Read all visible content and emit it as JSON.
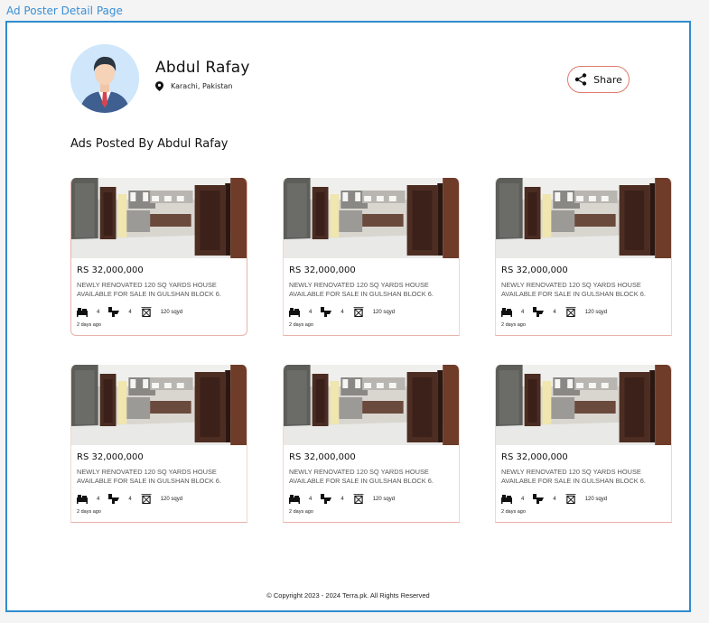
{
  "page_label": "Ad Poster Detail Page",
  "profile": {
    "name": "Abdul Rafay",
    "location": "Karachi, Pakistan",
    "avatar_icon": "businessman-avatar-icon"
  },
  "share": {
    "label": "Share",
    "icon": "share-icon"
  },
  "section_title": "Ads Posted By Abdul Rafay",
  "listings": [
    {
      "price": "RS 32,000,000",
      "title": "NEWLY RENOVATED 120 SQ YARDS HOUSE AVAILABLE FOR SALE IN GULSHAN BLOCK 6.",
      "beds": "4",
      "baths": "4",
      "area": "120 sqyd",
      "posted": "2 days ago"
    },
    {
      "price": "RS 32,000,000",
      "title": "NEWLY RENOVATED 120 SQ YARDS HOUSE AVAILABLE FOR SALE IN GULSHAN BLOCK 6.",
      "beds": "4",
      "baths": "4",
      "area": "120 sqyd",
      "posted": "2 days ago"
    },
    {
      "price": "RS 32,000,000",
      "title": "NEWLY RENOVATED 120 SQ YARDS HOUSE AVAILABLE FOR SALE IN GULSHAN BLOCK 6.",
      "beds": "4",
      "baths": "4",
      "area": "120 sqyd",
      "posted": "2 days ago"
    },
    {
      "price": "RS 32,000,000",
      "title": "NEWLY RENOVATED 120 SQ YARDS HOUSE AVAILABLE FOR SALE IN GULSHAN BLOCK 6.",
      "beds": "4",
      "baths": "4",
      "area": "120 sqyd",
      "posted": "2 days ago"
    },
    {
      "price": "RS 32,000,000",
      "title": "NEWLY RENOVATED 120 SQ YARDS HOUSE AVAILABLE FOR SALE IN GULSHAN BLOCK 6.",
      "beds": "4",
      "baths": "4",
      "area": "120 sqyd",
      "posted": "2 days ago"
    },
    {
      "price": "RS 32,000,000",
      "title": "NEWLY RENOVATED 120 SQ YARDS HOUSE AVAILABLE FOR SALE IN GULSHAN BLOCK 6.",
      "beds": "4",
      "baths": "4",
      "area": "120 sqyd",
      "posted": "2 days ago"
    }
  ],
  "footer": "© Copyright 2023 - 2024 Terra.pk. All Rights Reserved",
  "colors": {
    "frame_border": "#2f8ccf",
    "card_border": "#e8b3aa",
    "share_border": "#e07a6e",
    "label_blue": "#3a8fd6"
  }
}
